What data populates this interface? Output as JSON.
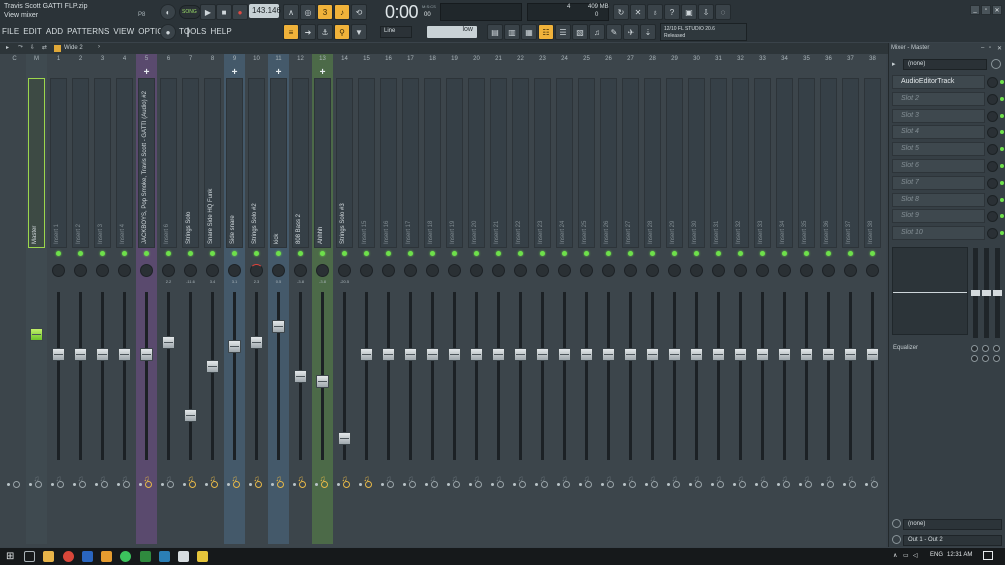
{
  "window": {
    "project_title": "Travis Scott GATTI FLP.zip",
    "hint": "View mixer",
    "menu": [
      "FILE",
      "EDIT",
      "ADD",
      "PATTERNS",
      "VIEW",
      "OPTIONS",
      "TOOLS",
      "HELP"
    ],
    "pattern_label": "P8",
    "song_mode_label": "SONG"
  },
  "transport": {
    "tempo": "143.146",
    "time": "0:00",
    "time_unit": "M:S:CS",
    "time_cs": "00",
    "cpu": "4",
    "memory": "409 MB",
    "polyphony": "0",
    "snap_mode": "Line",
    "snap_value": "low"
  },
  "news": {
    "line1": "12/10  FL STUDIO 20.6",
    "line2": "Released"
  },
  "mixer_toolbar": {
    "view_label": "Wide 2"
  },
  "mixer": {
    "strips": [
      {
        "num": "C",
        "name": "",
        "plus": false,
        "hl": "none"
      },
      {
        "num": "M",
        "name": "Master",
        "plus": false,
        "hl": "master"
      },
      {
        "num": "1",
        "name": "Insert 1",
        "plus": false,
        "hl": "none"
      },
      {
        "num": "2",
        "name": "Insert 2",
        "plus": false,
        "hl": "none"
      },
      {
        "num": "3",
        "name": "Insert 3",
        "plus": false,
        "hl": "none"
      },
      {
        "num": "4",
        "name": "Insert 4",
        "plus": false,
        "hl": "none"
      },
      {
        "num": "5",
        "name": "JACKBOYS, Pop Smoke, Travis Scott - GATTI (Audio) #2",
        "plus": true,
        "hl": "purple"
      },
      {
        "num": "6",
        "name": "Insert 6",
        "plus": false,
        "hl": "none"
      },
      {
        "num": "7",
        "name": "Strings Solo",
        "plus": false,
        "hl": "none"
      },
      {
        "num": "8",
        "name": "Snare Side HQ Funk",
        "plus": false,
        "hl": "none"
      },
      {
        "num": "9",
        "name": "Side snare",
        "plus": true,
        "hl": "blue"
      },
      {
        "num": "10",
        "name": "Strings Solo #2",
        "plus": false,
        "hl": "none"
      },
      {
        "num": "11",
        "name": "kick",
        "plus": true,
        "hl": "blue"
      },
      {
        "num": "12",
        "name": "808 Bass 2",
        "plus": false,
        "hl": "none"
      },
      {
        "num": "13",
        "name": "Ahhhh",
        "plus": true,
        "hl": "green"
      },
      {
        "num": "14",
        "name": "Strings Solo #3",
        "plus": false,
        "hl": "none"
      },
      {
        "num": "15",
        "name": "Insert 15",
        "plus": false,
        "hl": "none"
      },
      {
        "num": "16",
        "name": "Insert 16",
        "plus": false,
        "hl": "none"
      },
      {
        "num": "17",
        "name": "Insert 17",
        "plus": false,
        "hl": "none"
      },
      {
        "num": "18",
        "name": "Insert 18",
        "plus": false,
        "hl": "none"
      },
      {
        "num": "19",
        "name": "Insert 19",
        "plus": false,
        "hl": "none"
      },
      {
        "num": "20",
        "name": "Insert 20",
        "plus": false,
        "hl": "none"
      },
      {
        "num": "21",
        "name": "Insert 21",
        "plus": false,
        "hl": "none"
      },
      {
        "num": "22",
        "name": "Insert 22",
        "plus": false,
        "hl": "none"
      },
      {
        "num": "23",
        "name": "Insert 23",
        "plus": false,
        "hl": "none"
      },
      {
        "num": "24",
        "name": "Insert 24",
        "plus": false,
        "hl": "none"
      },
      {
        "num": "25",
        "name": "Insert 25",
        "plus": false,
        "hl": "none"
      },
      {
        "num": "26",
        "name": "Insert 26",
        "plus": false,
        "hl": "none"
      },
      {
        "num": "27",
        "name": "Insert 27",
        "plus": false,
        "hl": "none"
      },
      {
        "num": "28",
        "name": "Insert 28",
        "plus": false,
        "hl": "none"
      },
      {
        "num": "29",
        "name": "Insert 29",
        "plus": false,
        "hl": "none"
      },
      {
        "num": "30",
        "name": "Insert 30",
        "plus": false,
        "hl": "none"
      },
      {
        "num": "31",
        "name": "Insert 31",
        "plus": false,
        "hl": "none"
      },
      {
        "num": "32",
        "name": "Insert 32",
        "plus": false,
        "hl": "none"
      },
      {
        "num": "33",
        "name": "Insert 33",
        "plus": false,
        "hl": "none"
      },
      {
        "num": "34",
        "name": "Insert 34",
        "plus": false,
        "hl": "none"
      },
      {
        "num": "35",
        "name": "Insert 35",
        "plus": false,
        "hl": "none"
      },
      {
        "num": "36",
        "name": "Insert 36",
        "plus": false,
        "hl": "none"
      },
      {
        "num": "37",
        "name": "Insert 37",
        "plus": false,
        "hl": "none"
      },
      {
        "num": "38",
        "name": "Insert 38",
        "plus": false,
        "hl": "none"
      }
    ],
    "fader_levels": [
      0,
      0.75,
      0.63,
      0.63,
      0.63,
      0.63,
      0.63,
      0.7,
      0.27,
      0.56,
      0.68,
      0.7,
      0.8,
      0.5,
      0.47,
      0.13,
      0.63,
      0.63,
      0.63,
      0.63,
      0.63,
      0.63,
      0.63,
      0.63,
      0.63,
      0.63,
      0.63,
      0.63,
      0.63,
      0.63,
      0.63,
      0.63,
      0.63,
      0.63,
      0.63,
      0.63,
      0.63,
      0.63,
      0.63,
      0.63
    ],
    "knob_values": [
      "",
      "",
      "",
      "",
      "",
      "",
      "",
      "2.2",
      "-11.6",
      "3.4",
      "3.1",
      "2.3",
      "0.5",
      "-3.8",
      "-3.8",
      "-20.5",
      "",
      "",
      "",
      "",
      "",
      "",
      "",
      "",
      "",
      "",
      "",
      "",
      "",
      "",
      "",
      "",
      "",
      "",
      "",
      "",
      "",
      "",
      "",
      ""
    ],
    "routed": [
      false,
      false,
      false,
      false,
      false,
      false,
      true,
      false,
      true,
      true,
      true,
      true,
      true,
      true,
      true,
      true,
      true,
      false,
      false,
      false,
      false,
      false,
      false,
      false,
      false,
      false,
      false,
      false,
      false,
      false,
      false,
      false,
      false,
      false,
      false,
      false,
      false,
      false,
      false,
      false
    ]
  },
  "right_panel": {
    "title": "Mixer - Master",
    "input": "(none)",
    "slots": [
      "AudioEditorTrack",
      "Slot 2",
      "Slot 3",
      "Slot 4",
      "Slot 5",
      "Slot 6",
      "Slot 7",
      "Slot 8",
      "Slot 9",
      "Slot 10"
    ],
    "equalizer_label": "Equalizer",
    "output_none": "(none)",
    "output": "Out 1 - Out 2"
  },
  "taskbar": {
    "language": "ENG",
    "clock": "12:31 AM"
  }
}
